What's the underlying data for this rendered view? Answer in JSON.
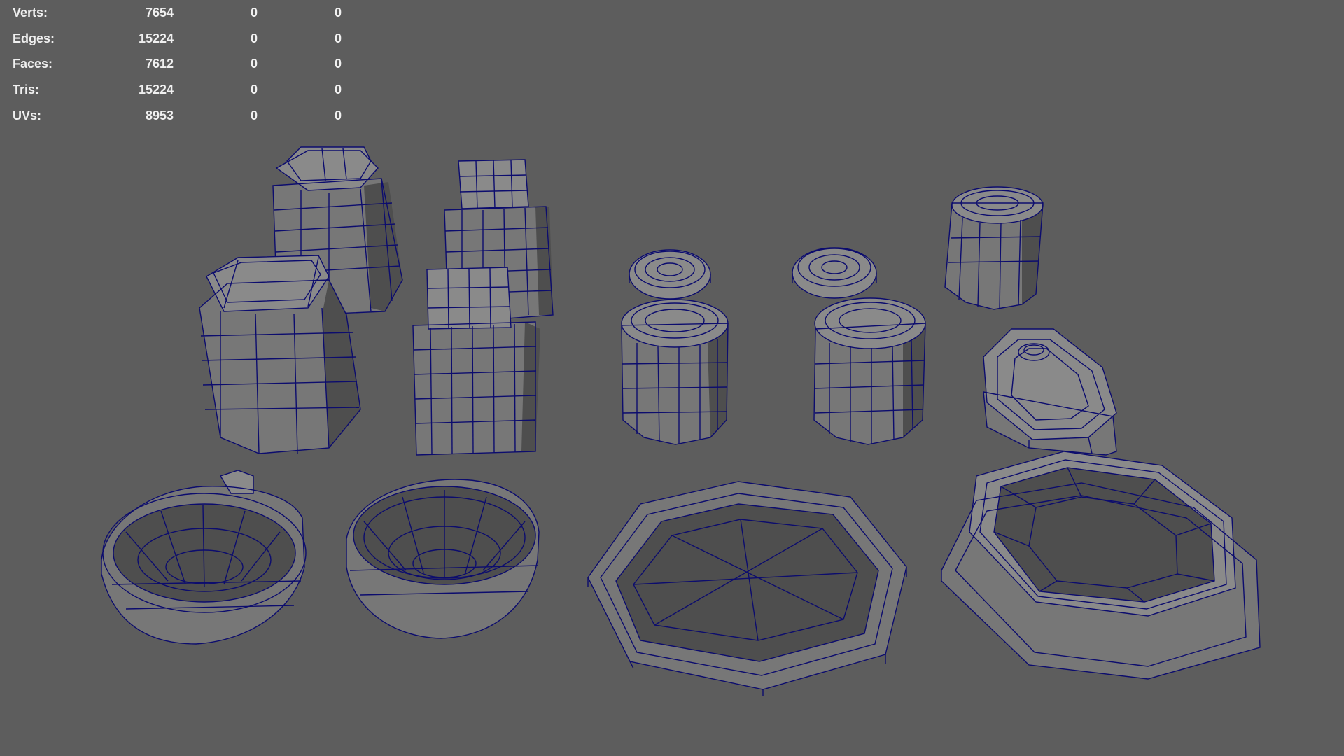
{
  "hud": {
    "rows": [
      {
        "label": "Verts:",
        "values": [
          "7654",
          "0",
          "0"
        ]
      },
      {
        "label": "Edges:",
        "values": [
          "15224",
          "0",
          "0"
        ]
      },
      {
        "label": "Faces:",
        "values": [
          "7612",
          "0",
          "0"
        ]
      },
      {
        "label": "Tris:",
        "values": [
          "15224",
          "0",
          "0"
        ]
      },
      {
        "label": "UVs:",
        "values": [
          "8953",
          "0",
          "0"
        ]
      }
    ]
  },
  "colors": {
    "viewport_background": "#5d5d5d",
    "wireframe": "#0c0c6e",
    "mesh_surface": "#777777",
    "hud_text": "#f0f0f0"
  }
}
